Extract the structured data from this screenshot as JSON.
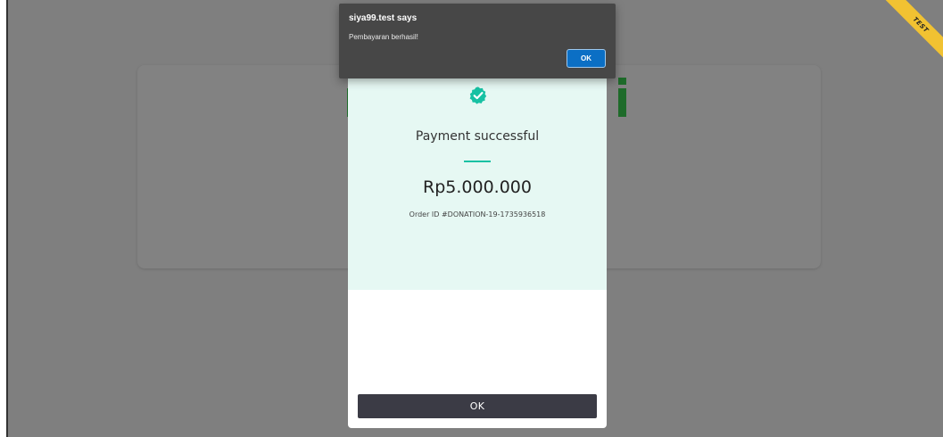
{
  "alert": {
    "title": "siya99.test says",
    "message": "Pembayaran berhasil!",
    "ok_label": "OK"
  },
  "modal": {
    "icon": "check-circle-icon",
    "success_title": "Payment successful",
    "amount": "Rp5.000.000",
    "order_line": "Order ID #DONATION-19-1735936518",
    "ok_label": "OK",
    "colors": {
      "success_bg": "#e6f8f3",
      "accent": "#17c1a3",
      "button_bg": "#3b3b45"
    }
  },
  "ribbon": {
    "label": "TEST",
    "color": "#f1c232"
  },
  "overlay": {
    "color": "#7f7f7f"
  }
}
